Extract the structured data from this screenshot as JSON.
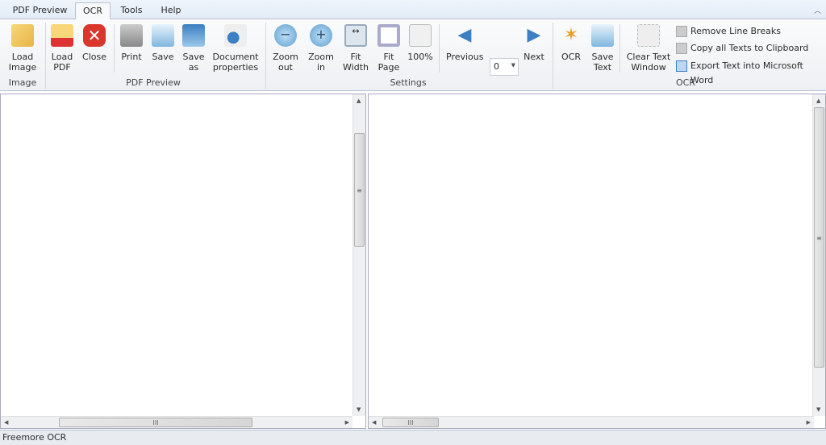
{
  "tabs": [
    {
      "label": "PDF Preview"
    },
    {
      "label": "OCR",
      "active": true
    },
    {
      "label": "Tools"
    },
    {
      "label": "Help"
    }
  ],
  "ribbon": {
    "image_group": {
      "label": "Image",
      "load_image": "Load Image"
    },
    "pdf_group": {
      "label": "PDF Preview",
      "load_pdf": "Load PDF",
      "close": "Close",
      "print": "Print",
      "save": "Save",
      "save_as": "Save as",
      "document_properties": "Document properties"
    },
    "settings_group": {
      "label": "Settings",
      "zoom_out": "Zoom out",
      "zoom_in": "Zoom in",
      "fit_width": "Fit Width",
      "fit_page": "Fit Page",
      "actual": "100%",
      "previous": "Previous",
      "page": "0",
      "next": "Next"
    },
    "ocr_group": {
      "label": "OCR",
      "ocr": "OCR",
      "save_text": "Save Text",
      "clear_text": "Clear Text Window",
      "remove_breaks": "Remove Line Breaks",
      "copy_all": "Copy all Texts to Clipboard",
      "export_word": "Export Text into Microsoft Word"
    }
  },
  "status": {
    "text": "Freemore OCR"
  },
  "colors": {
    "accent": "#3b7fc4",
    "close_red": "#d9372b",
    "folder": "#f2c55c"
  }
}
